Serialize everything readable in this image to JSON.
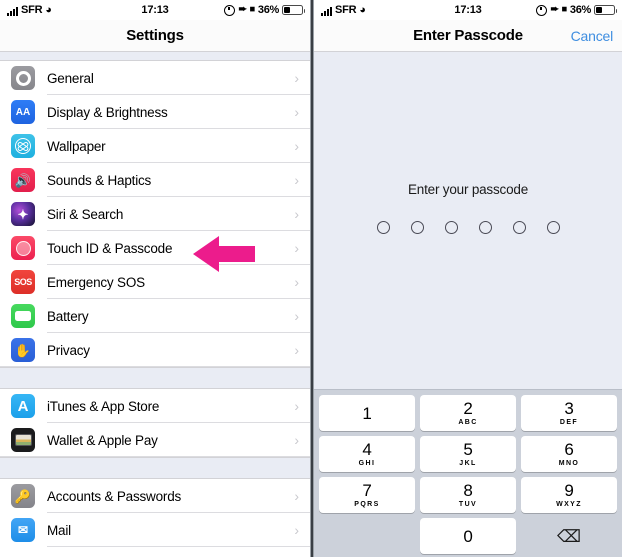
{
  "status_bar": {
    "carrier": "SFR",
    "wifi_icon": "wifi-icon",
    "time": "17:13",
    "alarm_icon": "alarm-clock-icon",
    "location_icon": "location-arrow-icon",
    "headphones_icon": "headphones-icon",
    "battery_percent": "36%",
    "battery_level": 36
  },
  "left_screen": {
    "nav": {
      "title": "Settings"
    },
    "sections": [
      {
        "rows": [
          {
            "label": "General",
            "icon": "gear-icon"
          },
          {
            "label": "Display & Brightness",
            "icon": "display-brightness-icon"
          },
          {
            "label": "Wallpaper",
            "icon": "wallpaper-icon"
          },
          {
            "label": "Sounds & Haptics",
            "icon": "sounds-haptics-icon"
          },
          {
            "label": "Siri & Search",
            "icon": "siri-search-icon"
          },
          {
            "label": "Touch ID & Passcode",
            "icon": "touch-id-icon"
          },
          {
            "label": "Emergency SOS",
            "icon": "emergency-sos-icon"
          },
          {
            "label": "Battery",
            "icon": "battery-icon"
          },
          {
            "label": "Privacy",
            "icon": "privacy-hand-icon"
          }
        ]
      },
      {
        "rows": [
          {
            "label": "iTunes & App Store",
            "icon": "app-store-icon"
          },
          {
            "label": "Wallet & Apple Pay",
            "icon": "wallet-icon"
          }
        ]
      },
      {
        "rows": [
          {
            "label": "Accounts & Passwords",
            "icon": "key-icon"
          },
          {
            "label": "Mail",
            "icon": "mail-icon"
          }
        ]
      }
    ],
    "chevron": "›",
    "annotation": {
      "type": "arrow-left",
      "color": "#ec1c8c",
      "points_to": "Touch ID & Passcode"
    }
  },
  "right_screen": {
    "nav": {
      "title": "Enter Passcode",
      "cancel_label": "Cancel"
    },
    "prompt": "Enter your passcode",
    "passcode_dots": 6,
    "passcode_filled": 0,
    "keypad": [
      [
        {
          "num": "1",
          "letters": ""
        },
        {
          "num": "2",
          "letters": "ABC"
        },
        {
          "num": "3",
          "letters": "DEF"
        }
      ],
      [
        {
          "num": "4",
          "letters": "GHI"
        },
        {
          "num": "5",
          "letters": "JKL"
        },
        {
          "num": "6",
          "letters": "MNO"
        }
      ],
      [
        {
          "num": "7",
          "letters": "PQRS"
        },
        {
          "num": "8",
          "letters": "TUV"
        },
        {
          "num": "9",
          "letters": "WXYZ"
        }
      ],
      [
        {
          "num": "",
          "letters": "",
          "blank": true
        },
        {
          "num": "0",
          "letters": ""
        },
        {
          "num": "⌫",
          "letters": "",
          "delete": true
        }
      ]
    ]
  },
  "colors": {
    "accent_blue": "#3f8ee0",
    "annotation_magenta": "#ec1c8c",
    "screen_bg": "#e9ecf4",
    "keypad_bg": "#ccd1da"
  }
}
